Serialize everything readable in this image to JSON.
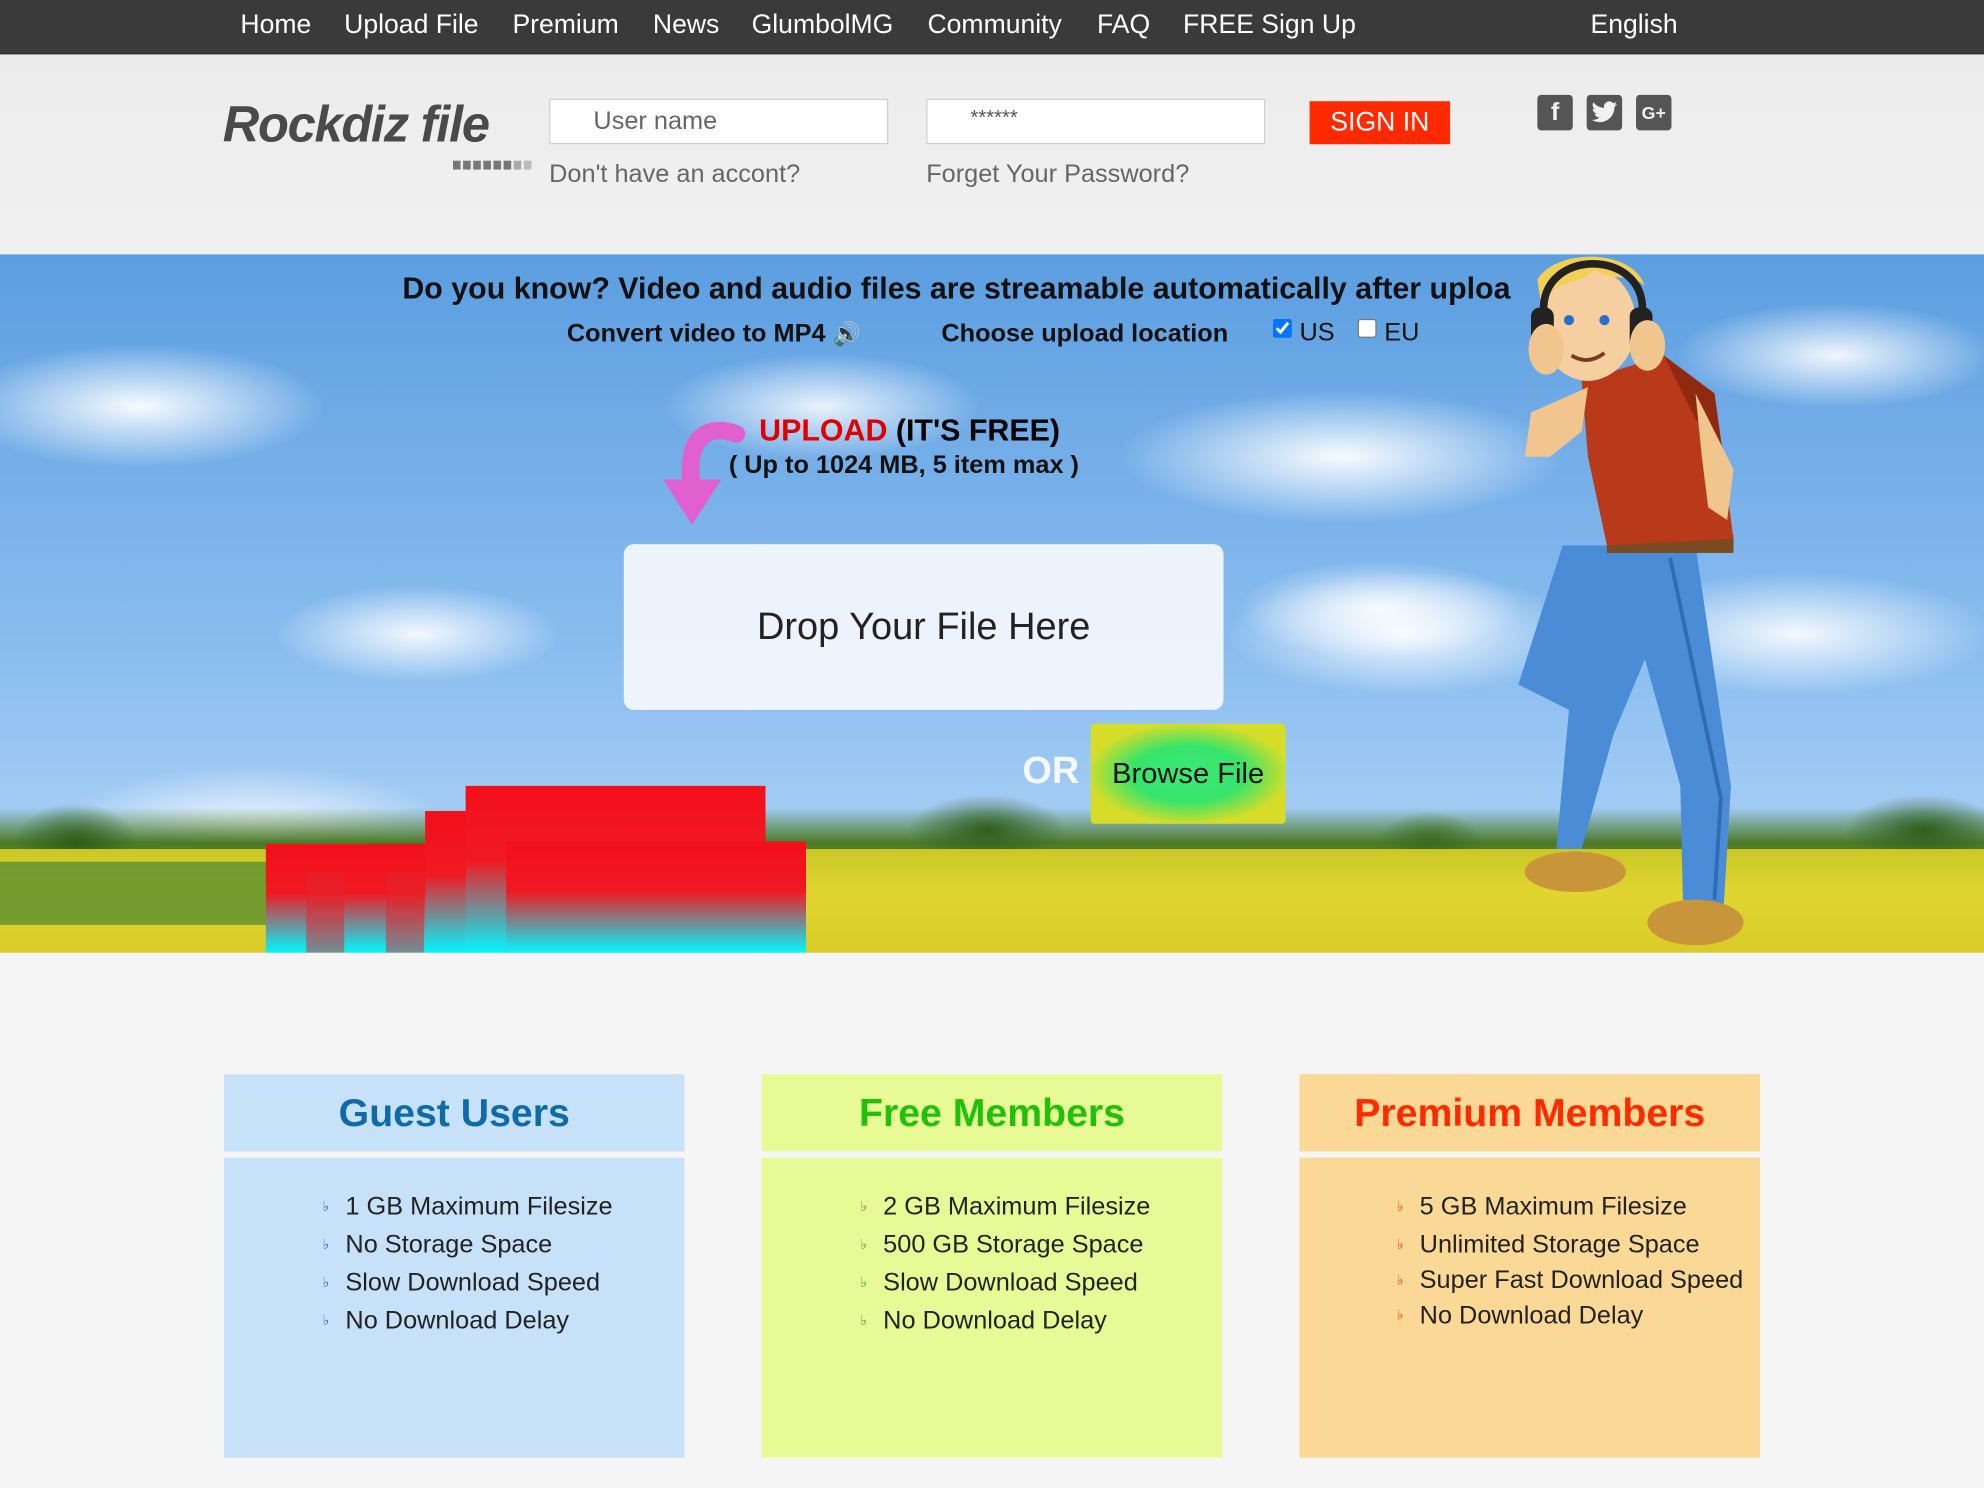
{
  "nav": {
    "items": [
      "Home",
      "Upload File",
      "Premium",
      "News",
      "GlumbolMG",
      "Community",
      "FAQ",
      "FREE Sign Up"
    ],
    "language": "English"
  },
  "header": {
    "logo_text": "Rockdiz file",
    "username_placeholder": "User name",
    "password_value": "******",
    "no_account_link": "Don't have an accont?",
    "forgot_link": "Forget Your Password?",
    "signin_label": "SIGN IN",
    "social_icons": [
      "facebook-icon",
      "twitter-icon",
      "google-plus-icon"
    ]
  },
  "hero": {
    "did_you_know": "Do you know? Video and audio files are streamable automatically after uploa",
    "convert_label": "Convert video to MP4",
    "location_label": "Choose upload location",
    "location_options": [
      {
        "label": "US",
        "checked": true
      },
      {
        "label": "EU",
        "checked": false
      }
    ],
    "upload_word": "UPLOAD",
    "upload_free": "(IT'S FREE)",
    "upload_limits": "( Up to 1024 MB, 5 item max )",
    "dropzone_label": "Drop Your File Here",
    "or_label": "OR",
    "browse_label": "Browse File"
  },
  "plans": [
    {
      "title": "Guest Users",
      "title_color": "#0e6aa8",
      "bullet_color": "#2a6fb0",
      "features": [
        "1 GB Maximum Filesize",
        "No Storage Space",
        "Slow Download Speed",
        "No Download Delay"
      ]
    },
    {
      "title": "Free Members",
      "title_color": "#22c00a",
      "bullet_color": "#3aa81a",
      "features": [
        "2 GB Maximum Filesize",
        "500 GB Storage Space",
        "Slow Download Speed",
        "No Download Delay"
      ]
    },
    {
      "title": "Premium Members",
      "title_color": "#ff2a00",
      "bullet_color": "#ff3a00",
      "features": [
        "5 GB Maximum Filesize",
        "Unlimited Storage Space",
        "Super Fast Download Speed",
        "No Download Delay"
      ]
    }
  ],
  "colors": {
    "nav_bg": "#3a3a3a",
    "signin_bg": "#ff2a00",
    "upload_red": "#e00000"
  }
}
